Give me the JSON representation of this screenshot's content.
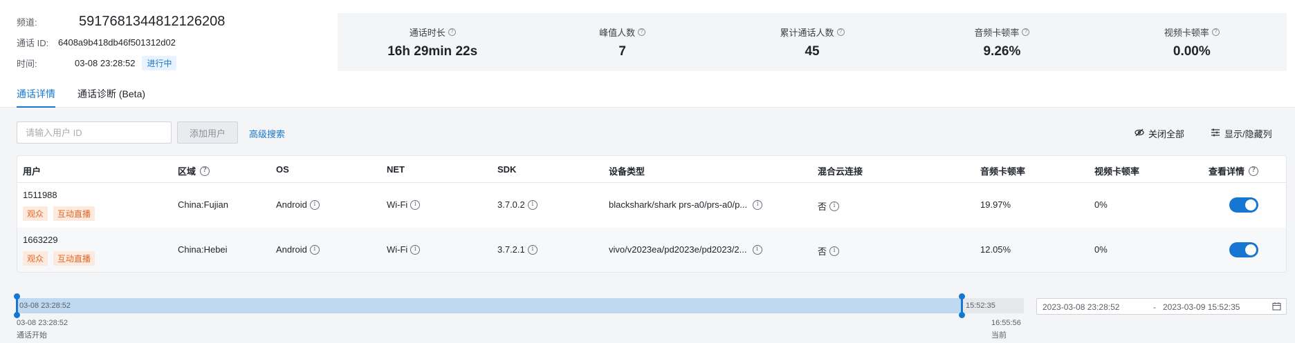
{
  "header": {
    "channel_label": "频道:",
    "channel_value": "5917681344812126208",
    "call_id_label": "通话 ID:",
    "call_id_value": "6408a9b418db46f501312d02",
    "time_label": "时间:",
    "time_value": "03-08 23:28:52",
    "status_tag": "进行中"
  },
  "stats": [
    {
      "title": "通话时长",
      "value": "16h 29min 22s"
    },
    {
      "title": "峰值人数",
      "value": "7"
    },
    {
      "title": "累计通话人数",
      "value": "45"
    },
    {
      "title": "音频卡顿率",
      "value": "9.26%"
    },
    {
      "title": "视频卡顿率",
      "value": "0.00%"
    }
  ],
  "tabs": [
    {
      "label": "通话详情",
      "active": true
    },
    {
      "label": "通话诊断 (Beta)",
      "active": false
    }
  ],
  "toolbar": {
    "search_placeholder": "请输入用户 ID",
    "add_user_label": "添加用户",
    "advanced_search_label": "高级搜索",
    "close_all_label": "关闭全部",
    "toggle_columns_label": "显示/隐藏列"
  },
  "table": {
    "headers": [
      "用户",
      "区域",
      "OS",
      "NET",
      "SDK",
      "设备类型",
      "混合云连接",
      "音频卡顿率",
      "视频卡顿率",
      "查看详情"
    ],
    "rows": [
      {
        "user_id": "1511988",
        "role_badge": "观众",
        "mode_badge": "互动直播",
        "region": "China:Fujian",
        "os": "Android",
        "net": "Wi-Fi",
        "sdk": "3.7.0.2",
        "device": "blackshark/shark prs-a0/prs-a0/p...",
        "hybrid_cloud": "否",
        "audio_stall": "19.97%",
        "video_stall": "0%",
        "detail_on": true
      },
      {
        "user_id": "1663229",
        "role_badge": "观众",
        "mode_badge": "互动直播",
        "region": "China:Hebei",
        "os": "Android",
        "net": "Wi-Fi",
        "sdk": "3.7.2.1",
        "device": "vivo/v2023ea/pd2023e/pd2023/2...",
        "hybrid_cloud": "否",
        "audio_stall": "12.05%",
        "video_stall": "0%",
        "detail_on": true
      }
    ]
  },
  "timeline": {
    "bar_start_text": "03-08 23:28:52",
    "bar_end_text": "15:52:35",
    "start_label": "03-08 23:28:52",
    "start_caption": "通话开始",
    "end_time": "16:55:56",
    "end_caption": "当前",
    "range_start": "2023-03-08 23:28:52",
    "range_sep": "-",
    "range_end": "2023-03-09 15:52:35"
  },
  "colors": {
    "accent": "#1677d2",
    "badge_text": "#e0692a",
    "badge_bg": "#fde9dd",
    "stats_bg": "#f4f5f7"
  }
}
